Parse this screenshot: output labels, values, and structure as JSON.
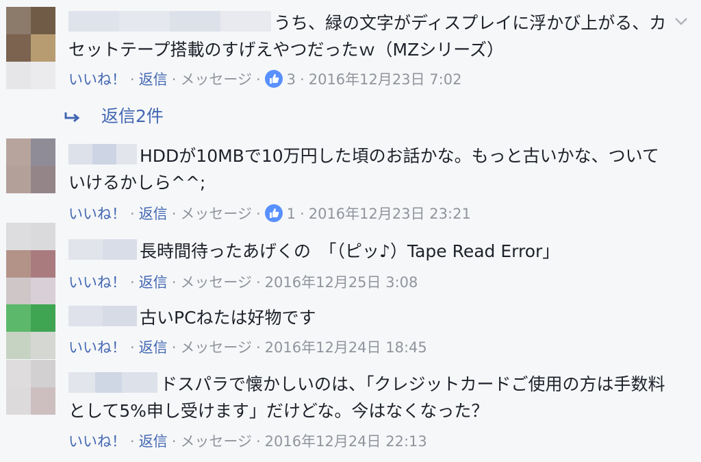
{
  "actions": {
    "like": "いいね！",
    "reply": "返信",
    "message": "メッセージ",
    "separator": "·"
  },
  "comments": [
    {
      "text": "うち、緑の文字がディスプレイに浮かび上がる、カセットテープ搭載のすげえやつだったｗ（MZシリーズ）",
      "reactions": "3",
      "timestamp": "2016年12月23日 7:02",
      "replies_label": "返信2件"
    },
    {
      "text": "HDDが10MBで10万円した頃のお話かな。もっと古いかな、ついていけるかしら^^;",
      "reactions": "1",
      "timestamp": "2016年12月23日 23:21"
    },
    {
      "text": "長時間待ったあげくの　「（ピッ♪）Tape Read Error」",
      "timestamp": "2016年12月25日 3:08"
    },
    {
      "text": "古いPCねたは好物です",
      "timestamp": "2016年12月24日 18:45"
    },
    {
      "text": "ドスパラで懐かしいのは、「クレジットカードご使用の方は手数料として5%申し受けます」だけどな。今はなくなった？",
      "timestamp": "2016年12月24日 22:13"
    }
  ],
  "colors": {
    "link": "#4267b2",
    "meta": "#90949c",
    "like_badge": "#5890ff",
    "background": "#f6f7f9"
  },
  "icons": {
    "options": "chevron-down-icon",
    "reply_arrow": "reply-arrow-icon",
    "like": "thumbs-up-icon"
  }
}
